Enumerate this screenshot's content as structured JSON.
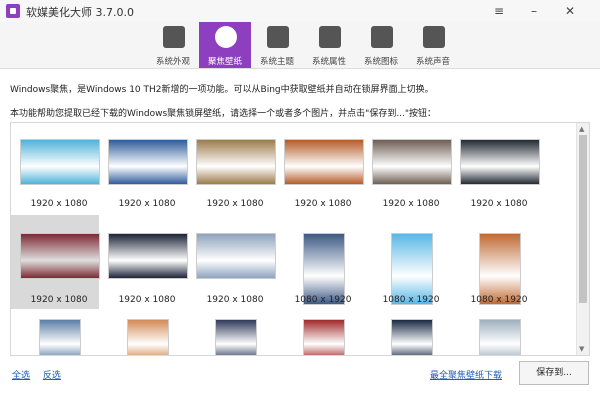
{
  "window": {
    "title": "软媒美化大师 3.7.0.0"
  },
  "toolbar": [
    {
      "label": "系统外观",
      "icon": "paint-brush-icon"
    },
    {
      "label": "聚焦壁纸",
      "icon": "camera-lens-icon",
      "active": true
    },
    {
      "label": "系统主题",
      "icon": "t-shirt-icon"
    },
    {
      "label": "系统属性",
      "icon": "oem-icon"
    },
    {
      "label": "系统图标",
      "icon": "star-icon"
    },
    {
      "label": "系统声音",
      "icon": "speaker-icon"
    }
  ],
  "content": {
    "intro_line1": "Windows聚焦，是Windows 10 TH2新增的一项功能。可以从Bing中获取壁纸并自动在锁屏界面上切换。",
    "intro_line2": "本功能帮助您提取已经下载的Windows聚焦锁屏壁纸，请选择一个或者多个图片，并点击\"保存到...\"按钮：",
    "thumbnails": [
      {
        "caption": "1920 x 1080",
        "color": "#4fb3d9"
      },
      {
        "caption": "1920 x 1080",
        "color": "#2e5d9a"
      },
      {
        "caption": "1920 x 1080",
        "color": "#9d7b4d"
      },
      {
        "caption": "1920 x 1080",
        "color": "#b65b2a"
      },
      {
        "caption": "1920 x 1080",
        "color": "#6e5f54"
      },
      {
        "caption": "1920 x 1080",
        "color": "#222a33"
      },
      {
        "caption": "1920 x 1080",
        "color": "#7d2a34"
      },
      {
        "caption": "1920 x 1080",
        "color": "#1c2438"
      },
      {
        "caption": "1920 x 1080",
        "color": "#8da3bd"
      },
      {
        "caption": "1080 x 1920",
        "color": "#3d5a85"
      },
      {
        "caption": "1080 x 1920",
        "color": "#58b7e6"
      },
      {
        "caption": "1080 x 1920",
        "color": "#c06b34"
      },
      {
        "caption": "",
        "color": "#5b7fa6"
      },
      {
        "caption": "",
        "color": "#d38b55"
      },
      {
        "caption": "",
        "color": "#2f3a5a"
      },
      {
        "caption": "",
        "color": "#a12a2a"
      },
      {
        "caption": "",
        "color": "#1a2a44"
      },
      {
        "caption": "",
        "color": "#9fb0be"
      }
    ]
  },
  "footer": {
    "select_all": "全选",
    "invert": "反选",
    "download_link": "最全聚焦壁纸下载",
    "save_button": "保存到..."
  }
}
